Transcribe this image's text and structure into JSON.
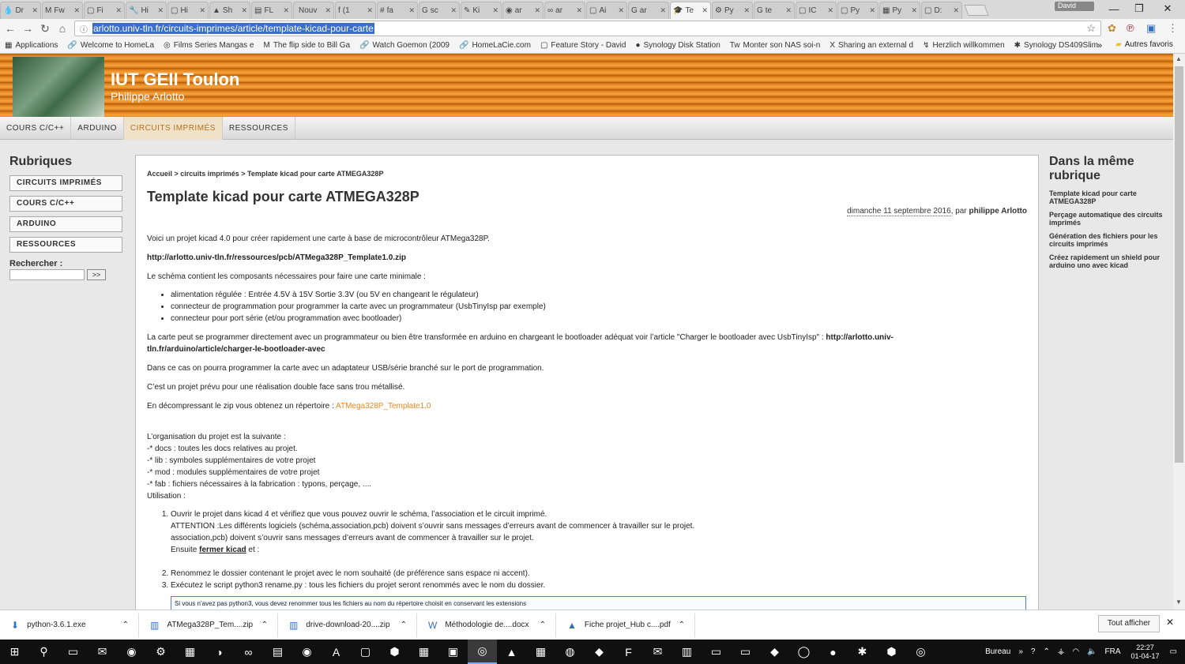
{
  "browser": {
    "tabs": [
      {
        "icon": "💧",
        "label": "Dr"
      },
      {
        "icon": "M",
        "label": "Fw"
      },
      {
        "icon": "▢",
        "label": "Fi"
      },
      {
        "icon": "🔧",
        "label": "Hi"
      },
      {
        "icon": "▢",
        "label": "Hi"
      },
      {
        "icon": "▲",
        "label": "Sh"
      },
      {
        "icon": "▤",
        "label": "FL"
      },
      {
        "icon": "",
        "label": "Nouv"
      },
      {
        "icon": "f",
        "label": "(1"
      },
      {
        "icon": "#",
        "label": "fa"
      },
      {
        "icon": "G",
        "label": "sc"
      },
      {
        "icon": "✎",
        "label": "Ki"
      },
      {
        "icon": "◉",
        "label": "ar"
      },
      {
        "icon": "∞",
        "label": "ar"
      },
      {
        "icon": "▢",
        "label": "Ai"
      },
      {
        "icon": "G",
        "label": "ar"
      },
      {
        "icon": "🎓",
        "label": "Te"
      },
      {
        "icon": "⚙",
        "label": "Py"
      },
      {
        "icon": "G",
        "label": "te"
      },
      {
        "icon": "▢",
        "label": "IC"
      },
      {
        "icon": "▢",
        "label": "Py"
      },
      {
        "icon": "▦",
        "label": "Py"
      },
      {
        "icon": "▢",
        "label": "D:"
      }
    ],
    "active_tab_index": 16,
    "profile_name": "David",
    "url": "arlotto.univ-tln.fr/circuits-imprimes/article/template-kicad-pour-carte",
    "bookmarks": [
      {
        "icon": "▦",
        "label": "Applications"
      },
      {
        "icon": "🔗",
        "label": "Welcome to HomeLa"
      },
      {
        "icon": "◎",
        "label": "Films Series Mangas e"
      },
      {
        "icon": "M",
        "label": "The flip side to Bill Ga"
      },
      {
        "icon": "🔗",
        "label": "Watch Goemon (2009"
      },
      {
        "icon": "🔗",
        "label": "HomeLaCie.com"
      },
      {
        "icon": "▢",
        "label": "Feature Story - David"
      },
      {
        "icon": "●",
        "label": "Synology Disk Station"
      },
      {
        "icon": "Tw",
        "label": "Monter son NAS soi-n"
      },
      {
        "icon": "X",
        "label": "Sharing an external d"
      },
      {
        "icon": "↯",
        "label": "Herzlich willkommen"
      },
      {
        "icon": "✱",
        "label": "Synology DS409Slim"
      }
    ],
    "bookmarks_more": "»",
    "other_bookmarks": "Autres favoris"
  },
  "site": {
    "title": "IUT GEII Toulon",
    "subtitle": "Philippe Arlotto",
    "nav": [
      "COURS C/C++",
      "ARDUINO",
      "CIRCUITS IMPRIMÉS",
      "RESSOURCES"
    ],
    "nav_active_index": 2
  },
  "left": {
    "title": "Rubriques",
    "buttons": [
      "CIRCUITS IMPRIMÉS",
      "COURS C/C++",
      "ARDUINO",
      "RESSOURCES"
    ],
    "search_label": "Rechercher :",
    "search_button": ">>"
  },
  "article": {
    "breadcrumb": "Accueil > circuits imprimés > Template kicad pour carte ATMEGA328P",
    "title": "Template kicad pour carte ATMEGA328P",
    "date": "dimanche 11 septembre 2016",
    "by": ", par ",
    "author": "philippe Arlotto",
    "p1": "Voici un projet kicad 4.0 pour créer rapidement une carte à base de microcontrôleur ATMega328P.",
    "p2": "http://arlotto.univ-tln.fr/ressources/pcb/ATMega328P_Template1.0.zip",
    "p3": "Le schéma contient les composants nécessaires pour faire une carte minimale :",
    "bullets": [
      " alimentation régulée : Entrée 4.5V à 15V Sortie 3.3V (ou 5V en changeant le régulateur)",
      "connecteur de programmation pour programmer la carte avec un programmateur (UsbTinyIsp par exemple)",
      "connecteur pour port série (et/ou programmation avec bootloader)"
    ],
    "p4a": "La carte peut se programmer directement avec un programmateur ou bien être transformée en arduino en chargeant le bootloader adéquat voir l’article \"Charger le bootloader avec UsbTinyIsp\" : ",
    "p4link": "http://arlotto.univ-tln.fr/arduino/article/charger-le-bootloader-avec",
    "p5": "Dans ce cas on pourra programmer la carte avec un adaptateur USB/série branché sur le port de programmation.",
    "p6": "C’est un projet prévu pour une réalisation double face sans trou métallisé.",
    "p7": "En décompressant le zip vous obtenez un répertoire : ",
    "p7link": "ATMega328P_Template1.0",
    "org_lines": [
      "L’organisation du projet est la suivante :",
      "-* docs : toutes les docs relatives au projet.",
      "-* lib : symboles supplémentaires de votre projet",
      "-* mod  : modules supplémentaires de votre projet",
      "-* fab : fichiers nécessaires à la fabrication : typons, perçage, ....",
      "Utilisation :"
    ],
    "steps": [
      {
        "lines": [
          "Ouvrir le projet dans kicad 4 et vérifiez que vous pouvez ouvrir le schéma, l’association et le circuit imprimé.",
          "ATTENTION :Les différents logiciels (schéma,association,pcb) doivent s’ouvrir sans messages d’erreurs avant de commencer à travailler sur le projet.",
          "association,pcb) doivent s’ouvrir sans messages d’erreurs avant de commencer à travailler sur le projet."
        ],
        "ensuite": "Ensuite ",
        "ensuite_b": "fermer kicad",
        "ensuite_end": " et :"
      },
      {
        "lines": [
          "Renommez le dossier contenant le projet avec le nom souhaité (de préférence sans espace ni accent)."
        ]
      },
      {
        "lines": [
          "Exécutez le script python3 rename.py : tous les fichiers du projet seront renommés avec le nom du dossier."
        ]
      }
    ],
    "note": "Si vous n’avez pas python3, vous devez renommer tous les fichiers au nom du répertoire choisit en conservant les extensions"
  },
  "right": {
    "title": "Dans la même rubrique",
    "links": [
      "Template kicad pour carte ATMEGA328P",
      "Perçage automatique des circuits imprimés",
      "Génération des fichiers pour les circuits imprimés",
      "Créez rapidement un shield pour arduino uno avec kicad"
    ]
  },
  "downloads": {
    "items": [
      {
        "icon": "⬇",
        "name": "python-3.6.1.exe"
      },
      {
        "icon": "▥",
        "name": "ATMega328P_Tem....zip"
      },
      {
        "icon": "▥",
        "name": "drive-download-20....zip"
      },
      {
        "icon": "W",
        "name": "Méthodologie de....docx"
      },
      {
        "icon": "▲",
        "name": "Fiche projet_Hub c....pdf"
      }
    ],
    "show_all": "Tout afficher"
  },
  "taskbar": {
    "icons": [
      "⊞",
      "⚲",
      "▭",
      "✉",
      "◉",
      "⚙",
      "▦",
      "◑",
      "∞",
      "▤",
      "◉",
      "A",
      "▢",
      "⬢",
      "▦",
      "▣",
      "◎",
      "▲",
      "▦",
      "◍",
      "◆",
      "F",
      "✉",
      "▥",
      "▭",
      "▭",
      "◆",
      "◯",
      "●",
      "✱",
      "⬢",
      "◎"
    ],
    "active_index": 16,
    "tray_label": "Bureau",
    "tray_more": "»",
    "lang": "FRA",
    "time": "22:27",
    "date": "01-04-17"
  }
}
